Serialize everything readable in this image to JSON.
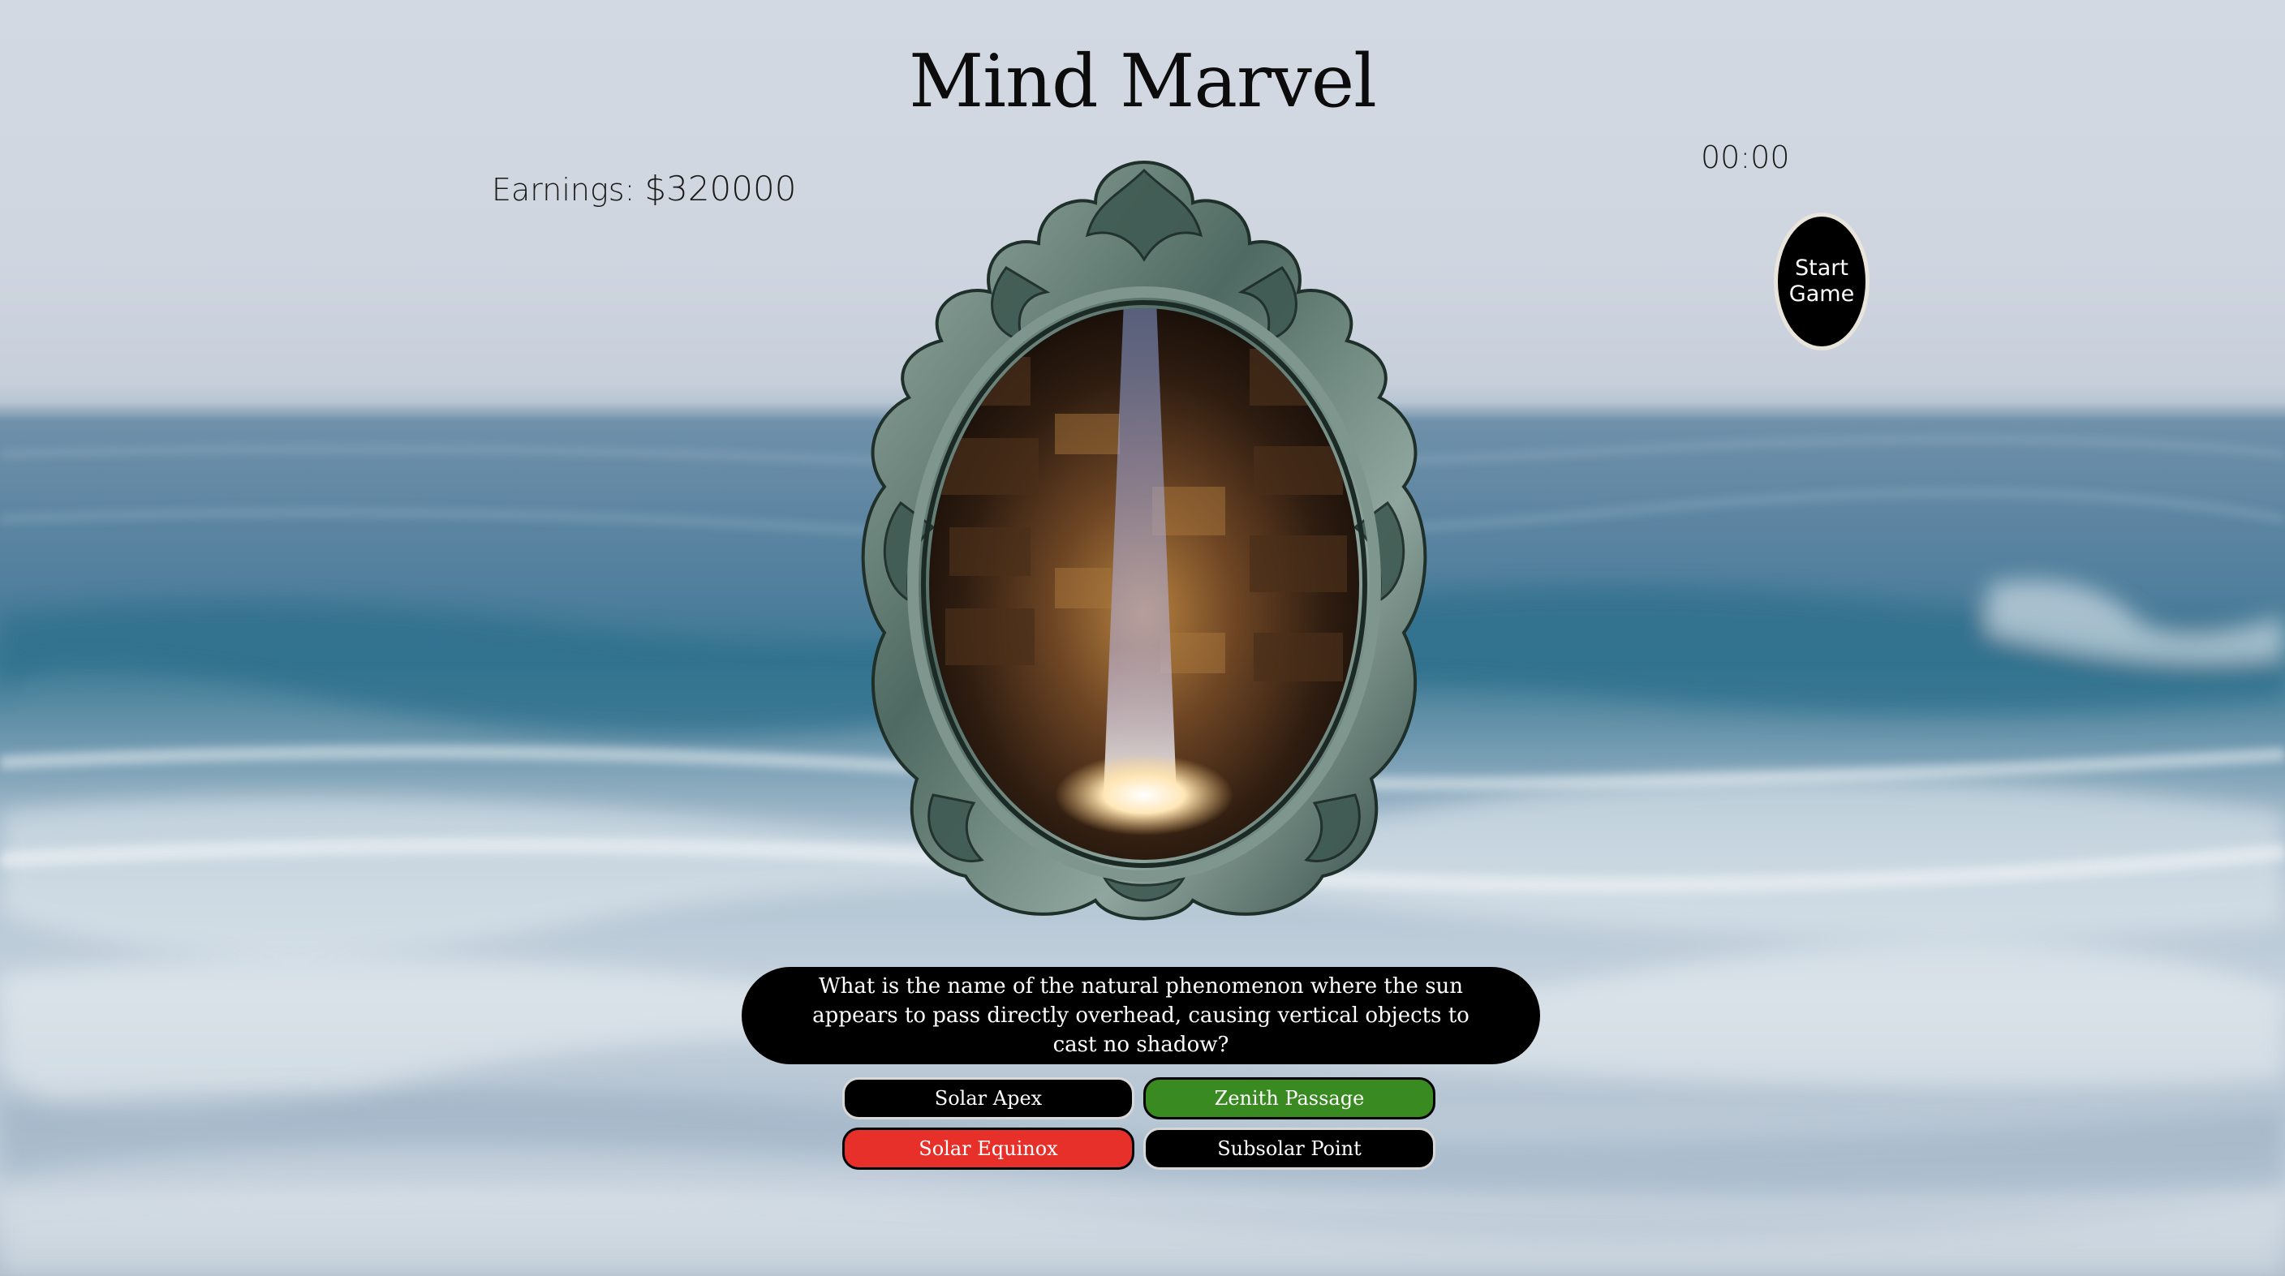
{
  "game": {
    "title": "Mind Marvel",
    "earnings_label": "Earnings:",
    "earnings_value": "$320000",
    "timer": "00:00",
    "start_button": "Start Game"
  },
  "question": {
    "text": "What is the name of the natural phenomenon where the sun appears to pass directly overhead, causing vertical objects to cast no shadow?",
    "image_icon": "mirror-cave-light-icon"
  },
  "answers": [
    {
      "label": "Solar Apex",
      "state": "neutral",
      "color": "#000000"
    },
    {
      "label": "Zenith Passage",
      "state": "correct",
      "color": "#3a8a22"
    },
    {
      "label": "Solar Equinox",
      "state": "incorrect",
      "color": "#e8302a"
    },
    {
      "label": "Subsolar Point",
      "state": "neutral",
      "color": "#000000"
    }
  ]
}
